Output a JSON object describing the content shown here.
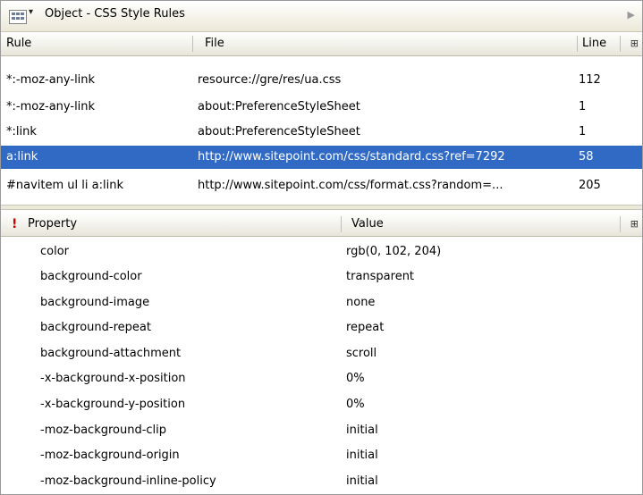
{
  "toolbar": {
    "title": "Object - CSS Style Rules",
    "caret": "▾",
    "arrow": "▶"
  },
  "rules_table": {
    "columns": {
      "rule": "Rule",
      "file": "File",
      "line": "Line"
    },
    "rows": [
      {
        "rule": "*:-moz-any-link",
        "file": "resource://gre/res/ua.css",
        "line": "112",
        "selected": false
      },
      {
        "rule": "*:-moz-any-link",
        "file": "about:PreferenceStyleSheet",
        "line": "1",
        "selected": false
      },
      {
        "rule": "*:link",
        "file": "about:PreferenceStyleSheet",
        "line": "1",
        "selected": false
      },
      {
        "rule": "a:link",
        "file": "http://www.sitepoint.com/css/standard.css?ref=7292",
        "line": "58",
        "selected": true
      },
      {
        "rule": "#navitem ul li a:link",
        "file": "http://www.sitepoint.com/css/format.css?random=...",
        "line": "205",
        "selected": false
      }
    ]
  },
  "props_table": {
    "columns": {
      "important": "!",
      "property": "Property",
      "value": "Value"
    },
    "rows": [
      {
        "property": "color",
        "value": "rgb(0, 102, 204)"
      },
      {
        "property": "background-color",
        "value": "transparent"
      },
      {
        "property": "background-image",
        "value": "none"
      },
      {
        "property": "background-repeat",
        "value": "repeat"
      },
      {
        "property": "background-attachment",
        "value": "scroll"
      },
      {
        "property": "-x-background-x-position",
        "value": "0%"
      },
      {
        "property": "-x-background-y-position",
        "value": "0%"
      },
      {
        "property": "-moz-background-clip",
        "value": "initial"
      },
      {
        "property": "-moz-background-origin",
        "value": "initial"
      },
      {
        "property": "-moz-background-inline-policy",
        "value": "initial"
      }
    ]
  },
  "colors": {
    "selection": "#316ac5",
    "important": "#d40000"
  },
  "icons": {
    "view_menu": "table-view-icon",
    "column_picker": "column-picker-icon",
    "scroll": "scroll-right-arrow-icon"
  }
}
